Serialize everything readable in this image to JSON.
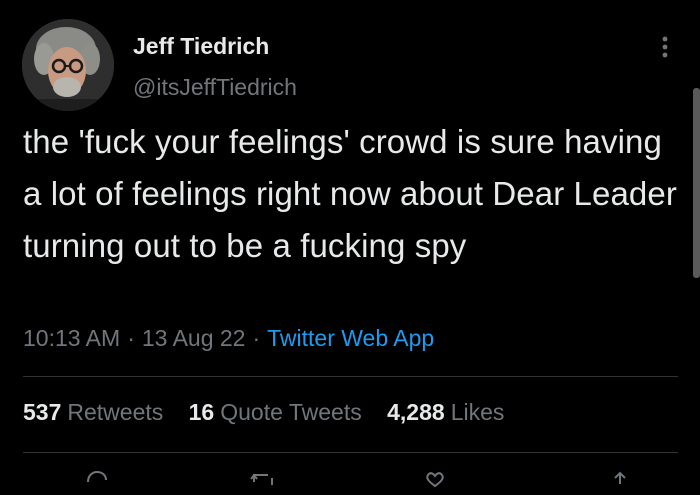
{
  "author": {
    "display_name": "Jeff Tiedrich",
    "handle": "@itsJeffTiedrich"
  },
  "tweet": {
    "text": "the 'fuck your feelings' crowd is sure having a lot of feelings right now about Dear Leader turning out to be a fucking spy",
    "time": "10:13 AM",
    "date": "13 Aug 22",
    "separator": "·",
    "source": "Twitter Web App"
  },
  "stats": {
    "retweets_count": "537",
    "retweets_label": "Retweets",
    "quotes_count": "16",
    "quotes_label": "Quote Tweets",
    "likes_count": "4,288",
    "likes_label": "Likes"
  },
  "icons": {
    "more": "more-options-icon",
    "reply": "reply-icon",
    "retweet": "retweet-icon",
    "like": "like-icon",
    "share": "share-icon"
  },
  "colors": {
    "background": "#000000",
    "text_primary": "#e7e9ea",
    "text_secondary": "#71767b",
    "link": "#1d9bf0",
    "divider": "#2f3336"
  }
}
